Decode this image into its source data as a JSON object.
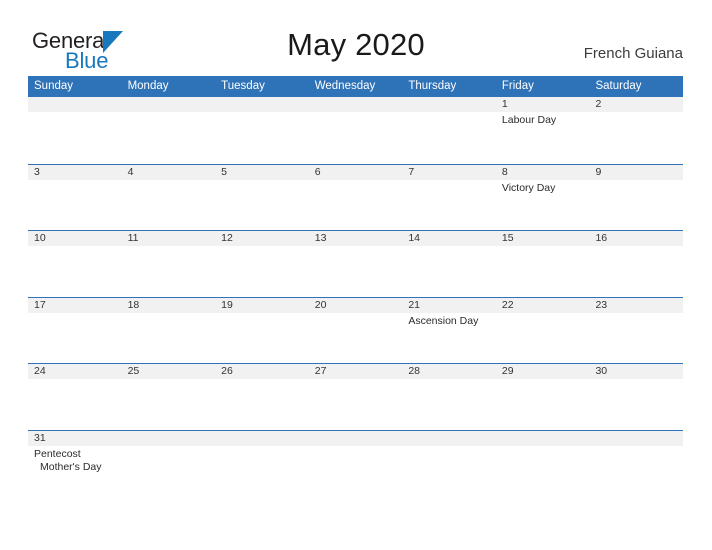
{
  "brand": {
    "word_one": "General",
    "word_two": "Blue",
    "primary_color": "#1878be"
  },
  "header": {
    "title": "May 2020",
    "region": "French Guiana",
    "header_bg": "#2e72b8",
    "date_band_bg": "#f1f1f1"
  },
  "weekdays": [
    {
      "label": "Sunday"
    },
    {
      "label": "Monday"
    },
    {
      "label": "Tuesday"
    },
    {
      "label": "Wednesday"
    },
    {
      "label": "Thursday"
    },
    {
      "label": "Friday"
    },
    {
      "label": "Saturday"
    }
  ],
  "weeks": [
    {
      "days": [
        {
          "date": "",
          "events": []
        },
        {
          "date": "",
          "events": []
        },
        {
          "date": "",
          "events": []
        },
        {
          "date": "",
          "events": []
        },
        {
          "date": "",
          "events": []
        },
        {
          "date": "1",
          "events": [
            {
              "name": "Labour Day",
              "indent": false
            }
          ]
        },
        {
          "date": "2",
          "events": []
        }
      ]
    },
    {
      "days": [
        {
          "date": "3",
          "events": []
        },
        {
          "date": "4",
          "events": []
        },
        {
          "date": "5",
          "events": []
        },
        {
          "date": "6",
          "events": []
        },
        {
          "date": "7",
          "events": []
        },
        {
          "date": "8",
          "events": [
            {
              "name": "Victory Day",
              "indent": false
            }
          ]
        },
        {
          "date": "9",
          "events": []
        }
      ]
    },
    {
      "days": [
        {
          "date": "10",
          "events": []
        },
        {
          "date": "11",
          "events": []
        },
        {
          "date": "12",
          "events": []
        },
        {
          "date": "13",
          "events": []
        },
        {
          "date": "14",
          "events": []
        },
        {
          "date": "15",
          "events": []
        },
        {
          "date": "16",
          "events": []
        }
      ]
    },
    {
      "days": [
        {
          "date": "17",
          "events": []
        },
        {
          "date": "18",
          "events": []
        },
        {
          "date": "19",
          "events": []
        },
        {
          "date": "20",
          "events": []
        },
        {
          "date": "21",
          "events": [
            {
              "name": "Ascension Day",
              "indent": false
            }
          ]
        },
        {
          "date": "22",
          "events": []
        },
        {
          "date": "23",
          "events": []
        }
      ]
    },
    {
      "days": [
        {
          "date": "24",
          "events": []
        },
        {
          "date": "25",
          "events": []
        },
        {
          "date": "26",
          "events": []
        },
        {
          "date": "27",
          "events": []
        },
        {
          "date": "28",
          "events": []
        },
        {
          "date": "29",
          "events": []
        },
        {
          "date": "30",
          "events": []
        }
      ]
    },
    {
      "days": [
        {
          "date": "31",
          "events": [
            {
              "name": "Pentecost",
              "indent": false
            },
            {
              "name": "Mother's Day",
              "indent": true
            }
          ]
        },
        {
          "date": "",
          "events": []
        },
        {
          "date": "",
          "events": []
        },
        {
          "date": "",
          "events": []
        },
        {
          "date": "",
          "events": []
        },
        {
          "date": "",
          "events": []
        },
        {
          "date": "",
          "events": []
        }
      ]
    }
  ]
}
